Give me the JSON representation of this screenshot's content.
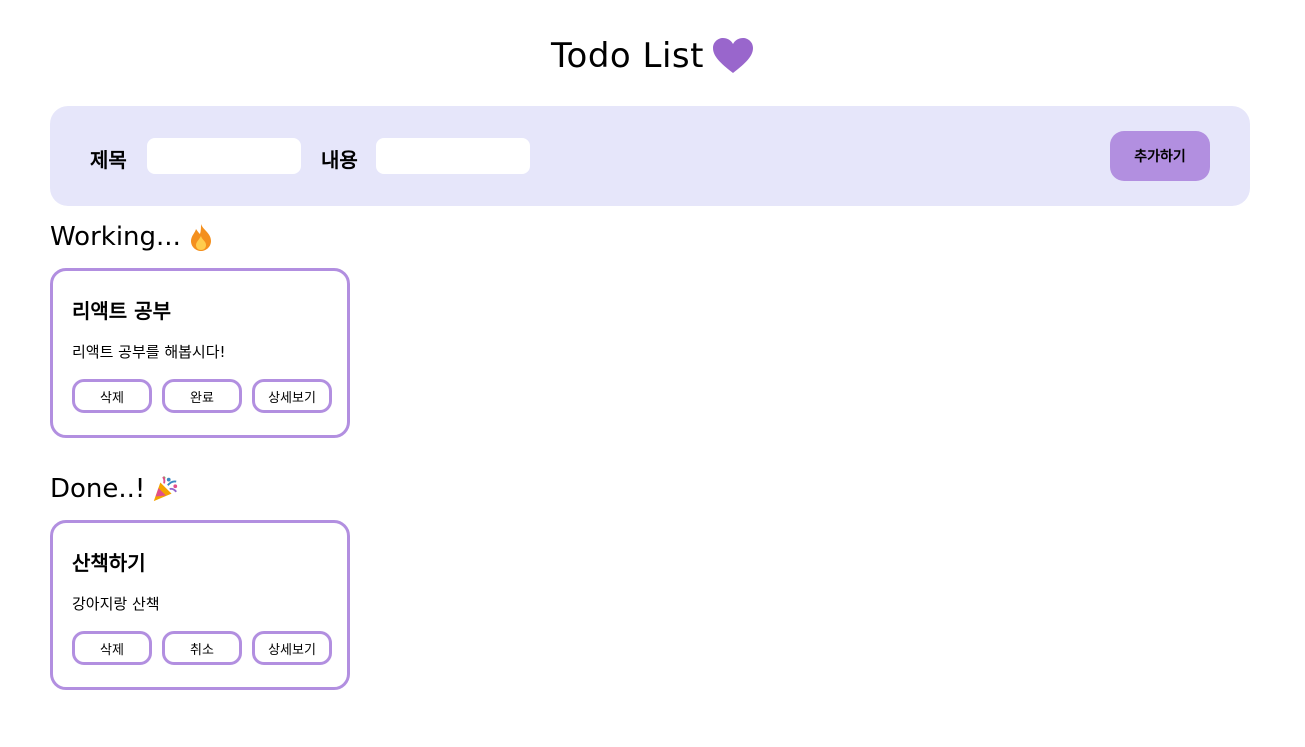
{
  "header": {
    "title": "Todo List",
    "heart_icon": "heart-icon",
    "heart_color": "#9966cc"
  },
  "form": {
    "title_label": "제목",
    "title_value": "",
    "content_label": "내용",
    "content_value": "",
    "add_button_label": "추가하기",
    "background": "#e6e6fa",
    "button_color": "#b28fe0"
  },
  "sections": {
    "working": {
      "heading": "Working...",
      "icon": "fire-icon"
    },
    "done": {
      "heading": "Done..!",
      "icon": "party-popper-icon"
    }
  },
  "working_todos": [
    {
      "title": "리액트 공부",
      "body": "리액트 공부를 해봅시다!",
      "delete_label": "삭제",
      "toggle_label": "완료",
      "detail_label": "상세보기"
    }
  ],
  "done_todos": [
    {
      "title": "산책하기",
      "body": "강아지랑 산책",
      "delete_label": "삭제",
      "toggle_label": "취소",
      "detail_label": "상세보기"
    }
  ],
  "accent_color": "#b28fe0"
}
